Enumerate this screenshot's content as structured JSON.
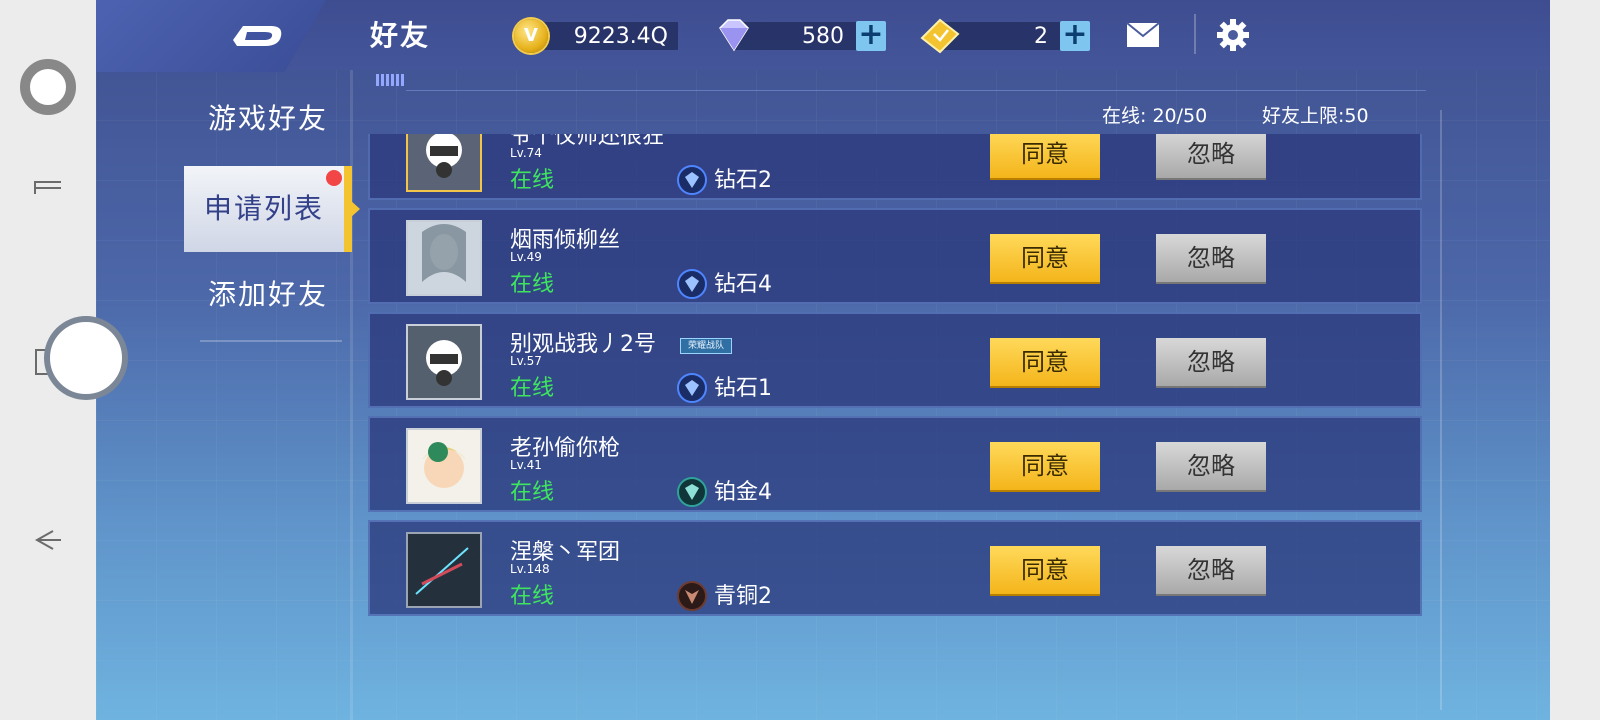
{
  "header": {
    "title": "好友",
    "coins": "9223.4Q",
    "coin_symbol": "V",
    "diamonds": "580",
    "tickets": "2"
  },
  "tabs": [
    {
      "label": "游戏好友"
    },
    {
      "label": "申请列表"
    },
    {
      "label": "添加好友"
    }
  ],
  "stats": {
    "online_label": "在线:",
    "online_value": "20/50",
    "limit_label": "好友上限:",
    "limit_value": "50"
  },
  "buttons": {
    "agree": "同意",
    "ignore": "忽略"
  },
  "requests": [
    {
      "name": "爷个仪师还很狂",
      "level": "Lv.74",
      "status": "在线",
      "rank": "钻石2",
      "rank_color": "#3a6fd8"
    },
    {
      "name": "烟雨倾柳丝",
      "level": "Lv.49",
      "status": "在线",
      "rank": "钻石4",
      "rank_color": "#3a6fd8"
    },
    {
      "name": "别观战我丿2号",
      "level": "Lv.57",
      "status": "在线",
      "rank": "钻石1",
      "rank_color": "#3a6fd8",
      "team_tag": "荣耀战队"
    },
    {
      "name": "老孙偷你枪",
      "level": "Lv.41",
      "status": "在线",
      "rank": "铂金4",
      "rank_color": "#2fa39a"
    },
    {
      "name": "涅槃丶军团",
      "level": "Lv.148",
      "status": "在线",
      "rank": "青铜2",
      "rank_color": "#6e3b2e"
    }
  ]
}
